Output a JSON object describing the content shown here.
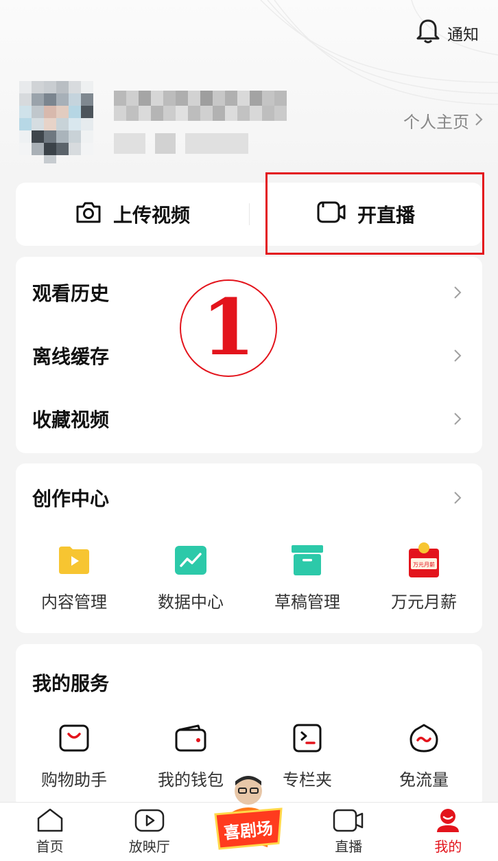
{
  "header": {
    "notify_label": "通知"
  },
  "profile": {
    "home_label": "个人主页"
  },
  "actions": {
    "upload_label": "上传视频",
    "live_label": "开直播"
  },
  "annotation": {
    "marker": "①"
  },
  "list": [
    {
      "label": "观看历史"
    },
    {
      "label": "离线缓存"
    },
    {
      "label": "收藏视频"
    }
  ],
  "creator": {
    "title": "创作中心",
    "items": [
      {
        "label": "内容管理",
        "icon": "content-manage-icon"
      },
      {
        "label": "数据中心",
        "icon": "data-center-icon"
      },
      {
        "label": "草稿管理",
        "icon": "draft-box-icon"
      },
      {
        "label": "万元月薪",
        "icon": "salary-envelope-icon"
      }
    ]
  },
  "services": {
    "title": "我的服务",
    "items": [
      {
        "label": "购物助手",
        "icon": "shopping-bag-icon"
      },
      {
        "label": "我的钱包",
        "icon": "wallet-icon"
      },
      {
        "label": "专栏夹",
        "icon": "column-folder-icon"
      },
      {
        "label": "免流量",
        "icon": "free-data-icon"
      }
    ]
  },
  "tabbar": {
    "tabs": [
      {
        "label": "首页"
      },
      {
        "label": "放映厅"
      },
      {
        "label": ""
      },
      {
        "label": "直播"
      },
      {
        "label": "我的"
      }
    ],
    "promo_text": "喜剧场"
  },
  "colors": {
    "accent": "#e3141c",
    "creator_yellow": "#f7c531",
    "creator_teal": "#2cc9a9"
  }
}
